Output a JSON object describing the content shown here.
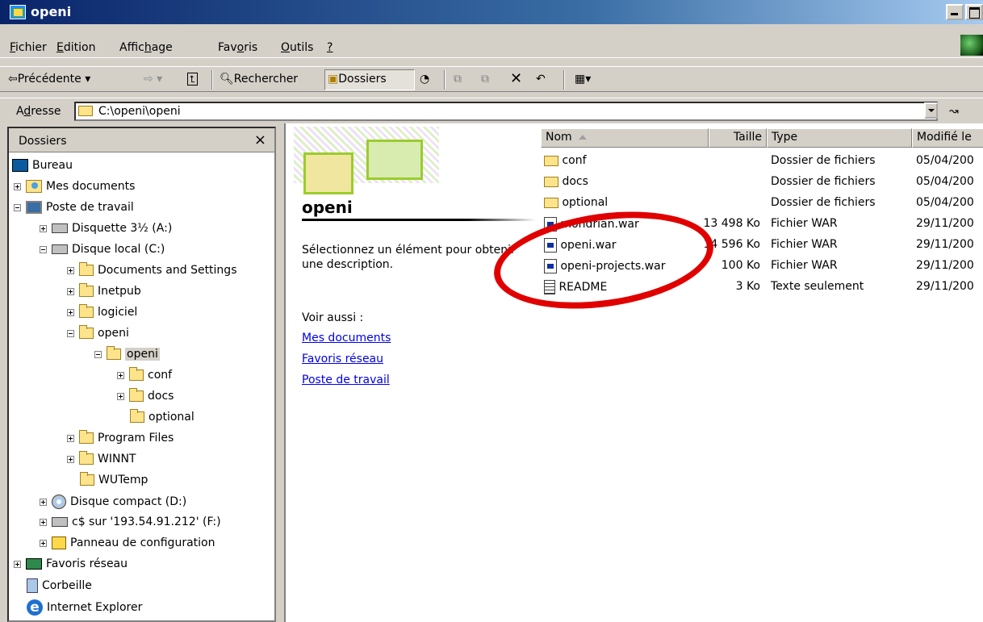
{
  "window": {
    "title": "openi"
  },
  "menubar": {
    "items": [
      {
        "ul": "F",
        "rest": "ichier"
      },
      {
        "ul": "E",
        "rest": "dition"
      },
      {
        "pre": "Affic",
        "ul": "h",
        "rest": "age"
      },
      {
        "pre": "Fav",
        "ul": "o",
        "rest": "ris"
      },
      {
        "ul": "O",
        "rest": "utils"
      },
      {
        "ul": "?",
        "rest": ""
      }
    ]
  },
  "toolbar": {
    "back_label": "Précédente",
    "search_label": "Rechercher",
    "folders_label": "Dossiers"
  },
  "address": {
    "label_ul": "d",
    "label_pre": "A",
    "label_rest": "resse",
    "value": "C:\\openi\\openi"
  },
  "folders_pane": {
    "title": "Dossiers",
    "close_glyph": "×",
    "tree": [
      {
        "label": "Bureau",
        "icon": "desktop-icon"
      },
      {
        "label": "Mes documents",
        "icon": "my-documents-icon"
      },
      {
        "label": "Poste de travail",
        "icon": "my-computer-icon"
      },
      {
        "label": "Disquette 3½ (A:)",
        "icon": "floppy-icon"
      },
      {
        "label": "Disque local (C:)",
        "icon": "hard-drive-icon"
      },
      {
        "label": "Documents and Settings",
        "icon": "folder-icon"
      },
      {
        "label": "Inetpub",
        "icon": "folder-icon"
      },
      {
        "label": "logiciel",
        "icon": "folder-icon"
      },
      {
        "label": "openi",
        "icon": "folder-icon"
      },
      {
        "label": "openi",
        "icon": "open-folder-icon"
      },
      {
        "label": "conf",
        "icon": "folder-icon"
      },
      {
        "label": "docs",
        "icon": "folder-icon"
      },
      {
        "label": "optional",
        "icon": "folder-icon"
      },
      {
        "label": "Program Files",
        "icon": "folder-icon"
      },
      {
        "label": "WINNT",
        "icon": "folder-icon"
      },
      {
        "label": "WUTemp",
        "icon": "folder-icon"
      },
      {
        "label": "Disque compact (D:)",
        "icon": "cd-drive-icon"
      },
      {
        "label": "c$ sur '193.54.91.212' (F:)",
        "icon": "network-drive-icon"
      },
      {
        "label": "Panneau de configuration",
        "icon": "control-panel-icon"
      },
      {
        "label": "Favoris réseau",
        "icon": "network-places-icon"
      },
      {
        "label": "Corbeille",
        "icon": "recycle-bin-icon"
      },
      {
        "label": "Internet Explorer",
        "icon": "internet-explorer-icon"
      }
    ]
  },
  "webview": {
    "folder_name": "openi",
    "description": "Sélectionnez un élément pour obtenir une description.",
    "see_also": "Voir aussi :",
    "links": [
      "Mes documents",
      "Favoris réseau",
      "Poste de travail"
    ]
  },
  "filelist": {
    "columns": [
      "Nom",
      "Taille",
      "Type",
      "Modifié le"
    ],
    "rows": [
      {
        "name": "conf",
        "size": "",
        "type": "Dossier de fichiers",
        "modified": "05/04/200",
        "icon": "folder-icon"
      },
      {
        "name": "docs",
        "size": "",
        "type": "Dossier de fichiers",
        "modified": "05/04/200",
        "icon": "folder-icon"
      },
      {
        "name": "optional",
        "size": "",
        "type": "Dossier de fichiers",
        "modified": "05/04/200",
        "icon": "folder-icon"
      },
      {
        "name": "mondrian.war",
        "size": "13 498 Ko",
        "type": "Fichier WAR",
        "modified": "29/11/200",
        "icon": "war-file-icon"
      },
      {
        "name": "openi.war",
        "size": "14 596 Ko",
        "type": "Fichier WAR",
        "modified": "29/11/200",
        "icon": "war-file-icon"
      },
      {
        "name": "openi-projects.war",
        "size": "100 Ko",
        "type": "Fichier WAR",
        "modified": "29/11/200",
        "icon": "war-file-icon"
      },
      {
        "name": "README",
        "size": "3 Ko",
        "type": "Texte seulement",
        "modified": "29/11/200",
        "icon": "text-file-icon"
      }
    ]
  },
  "colors": {
    "title_active": "#0a246a",
    "highlight_circle": "#e00000",
    "link": "#0000ee"
  }
}
